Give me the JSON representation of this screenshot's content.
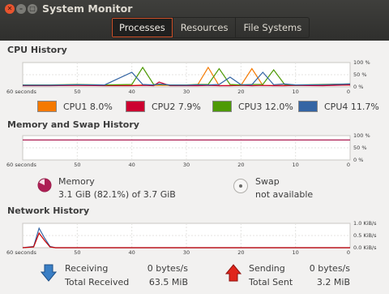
{
  "window": {
    "title": "System Monitor"
  },
  "tabs": [
    {
      "label": "Processes",
      "active": true
    },
    {
      "label": "Resources",
      "active": false
    },
    {
      "label": "File Systems",
      "active": false
    }
  ],
  "cpu": {
    "title": "CPU History",
    "x_ticks": [
      "60 seconds",
      "50",
      "40",
      "30",
      "20",
      "10",
      "0"
    ],
    "y_ticks": [
      "100 %",
      "50 %",
      "0 %"
    ],
    "cores": [
      {
        "label": "CPU1",
        "value": "8.0%",
        "color": "#f57900"
      },
      {
        "label": "CPU2",
        "value": "7.9%",
        "color": "#cc0030"
      },
      {
        "label": "CPU3",
        "value": "12.0%",
        "color": "#4e9a06"
      },
      {
        "label": "CPU4",
        "value": "11.7%",
        "color": "#3465a4"
      }
    ]
  },
  "memory": {
    "title": "Memory and Swap History",
    "x_ticks": [
      "60 seconds",
      "50",
      "40",
      "30",
      "20",
      "10",
      "0"
    ],
    "y_ticks": [
      "100 %",
      "50 %",
      "0 %"
    ],
    "memory_label": "Memory",
    "memory_value": "3.1 GiB (82.1%) of 3.7 GiB",
    "memory_fraction": 0.821,
    "memory_color": "#ad1f54",
    "swap_label": "Swap",
    "swap_value": "not available"
  },
  "network": {
    "title": "Network History",
    "x_ticks": [
      "60 seconds",
      "50",
      "40",
      "30",
      "20",
      "10",
      "0"
    ],
    "y_ticks": [
      "1.0 KiB/s",
      "0.5 KiB/s",
      "0.0 KiB/s"
    ],
    "receiving_label": "Receiving",
    "receiving_rate": "0 bytes/s",
    "total_received_label": "Total Received",
    "total_received": "63.5 MiB",
    "sending_label": "Sending",
    "sending_rate": "0 bytes/s",
    "total_sent_label": "Total Sent",
    "total_sent": "3.2 MiB"
  },
  "chart_data": [
    {
      "type": "line",
      "title": "CPU History",
      "x": [
        60,
        55,
        50,
        45,
        40,
        38,
        36,
        35,
        33,
        30,
        28,
        26,
        24,
        22,
        20,
        18,
        16,
        14,
        12,
        10,
        5,
        0
      ],
      "xlim": [
        60,
        0
      ],
      "ylim": [
        0,
        100
      ],
      "series": [
        {
          "name": "CPU1",
          "color": "#f57900",
          "values": [
            6,
            6,
            6,
            6,
            6,
            8,
            6,
            6,
            6,
            6,
            6,
            80,
            5,
            6,
            6,
            75,
            6,
            6,
            6,
            6,
            6,
            8
          ]
        },
        {
          "name": "CPU2",
          "color": "#cc0030",
          "values": [
            5,
            5,
            6,
            5,
            5,
            6,
            5,
            20,
            5,
            5,
            5,
            6,
            5,
            5,
            6,
            5,
            6,
            5,
            5,
            6,
            5,
            8
          ]
        },
        {
          "name": "CPU3",
          "color": "#4e9a06",
          "values": [
            8,
            8,
            10,
            8,
            10,
            80,
            10,
            10,
            8,
            8,
            10,
            10,
            75,
            10,
            8,
            10,
            10,
            70,
            10,
            8,
            10,
            12
          ]
        },
        {
          "name": "CPU4",
          "color": "#3465a4",
          "values": [
            7,
            7,
            9,
            8,
            60,
            10,
            8,
            12,
            8,
            7,
            9,
            8,
            10,
            40,
            9,
            9,
            60,
            9,
            12,
            8,
            9,
            12
          ]
        }
      ]
    },
    {
      "type": "line",
      "title": "Memory and Swap History",
      "x": [
        60,
        50,
        40,
        30,
        20,
        10,
        0
      ],
      "xlim": [
        60,
        0
      ],
      "ylim": [
        0,
        100
      ],
      "series": [
        {
          "name": "Memory",
          "color": "#ad1f54",
          "values": [
            82,
            82,
            82,
            82,
            82,
            82,
            82
          ]
        }
      ]
    },
    {
      "type": "line",
      "title": "Network History",
      "x": [
        60,
        58,
        57,
        56,
        55,
        54,
        50,
        40,
        30,
        20,
        10,
        0
      ],
      "xlim": [
        60,
        0
      ],
      "ylim": [
        0,
        1.0
      ],
      "series": [
        {
          "name": "Receiving",
          "color": "#3465a4",
          "values": [
            0,
            0.05,
            0.8,
            0.4,
            0.05,
            0,
            0,
            0,
            0,
            0,
            0,
            0
          ]
        },
        {
          "name": "Sending",
          "color": "#cc0000",
          "values": [
            0,
            0.03,
            0.6,
            0.3,
            0.03,
            0,
            0,
            0,
            0,
            0,
            0,
            0
          ]
        }
      ]
    }
  ]
}
